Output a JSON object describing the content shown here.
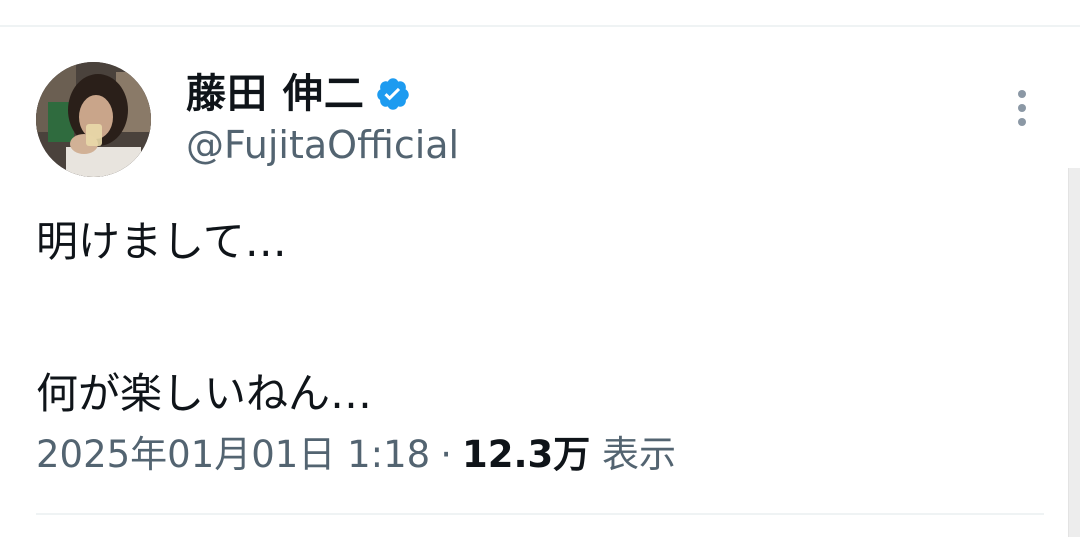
{
  "tweet": {
    "author": {
      "display_name": "藤田 伸二",
      "handle": "@FujitaOfficial",
      "verified": true,
      "verified_color": "#1d9bf0"
    },
    "text_lines": [
      "明けまして…",
      "",
      "何が楽しいねん…"
    ],
    "timestamp": "2025年01月01日 1:18",
    "separator": "·",
    "views_count": "12.3万",
    "views_label": "表示",
    "more_icon": "more-vertical-icon"
  },
  "colors": {
    "text_primary": "#0f1419",
    "text_secondary": "#536471",
    "divider": "#eff3f4"
  }
}
